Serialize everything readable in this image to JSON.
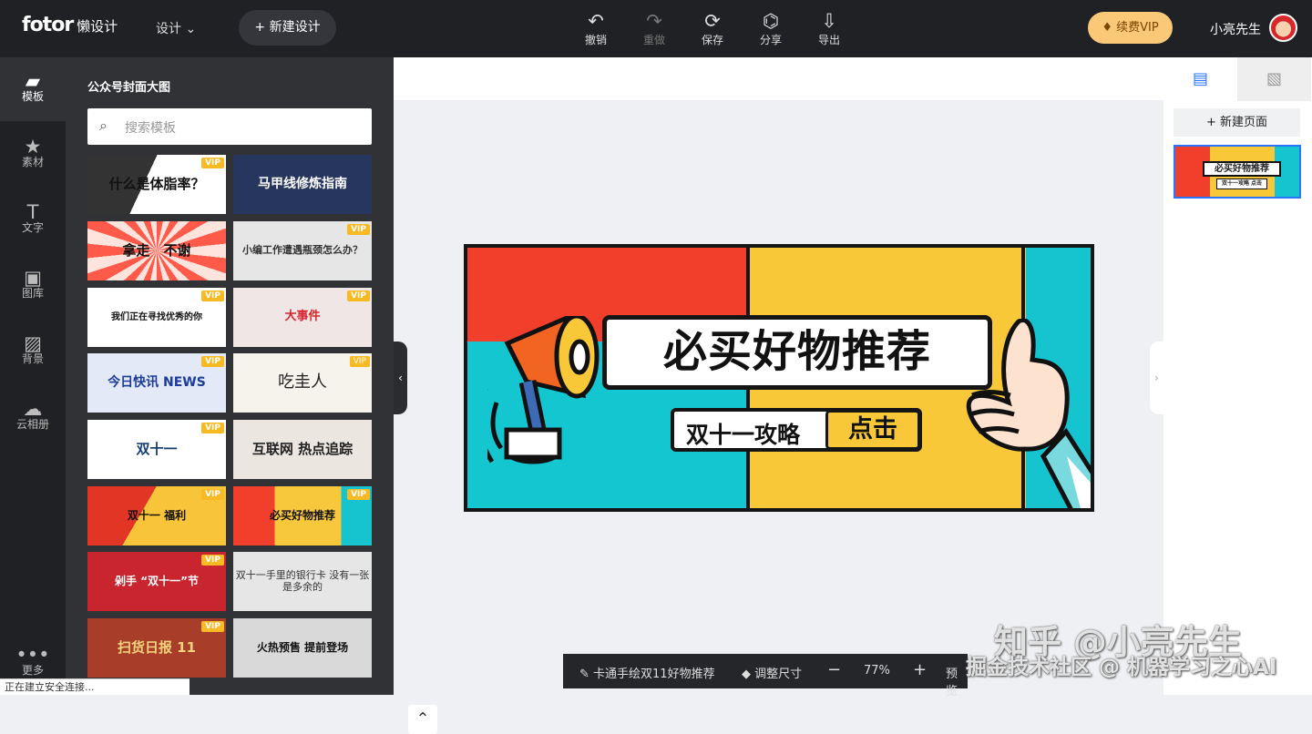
{
  "app": {
    "logo": "fotor",
    "logo_sub": "懒设计",
    "design_menu": "设计 ⌄",
    "new_design": "+ 新建设计"
  },
  "toolbar": {
    "undo": "撤销",
    "redo": "重做",
    "save": "保存",
    "share": "分享",
    "export": "导出",
    "vip": "续费VIP",
    "user": "小亮先生"
  },
  "icons": {
    "undo": "undo-icon",
    "redo": "redo-icon",
    "save": "save-icon",
    "share": "share-icon",
    "export": "export-icon"
  },
  "rail": [
    {
      "label": "模板"
    },
    {
      "label": "素材"
    },
    {
      "label": "文字"
    },
    {
      "label": "图库"
    },
    {
      "label": "背景"
    },
    {
      "label": "云相册"
    },
    {
      "label": "更多"
    }
  ],
  "panel": {
    "title": "公众号封面大图",
    "search_placeholder": "搜索模板"
  },
  "templates": [
    {
      "text": "什么是体脂率？",
      "vip": "VIP"
    },
    {
      "text": "马甲线修炼指南",
      "vip": ""
    },
    {
      "text": "拿走　不谢",
      "vip": ""
    },
    {
      "text": "小编工作遭遇瓶颈怎么办？",
      "vip": "VIP"
    },
    {
      "text": "我们正在寻找优秀的你",
      "vip": "VIP"
    },
    {
      "text": "大事件",
      "vip": "VIP"
    },
    {
      "text": "今日快讯 NEWS",
      "vip": "VIP"
    },
    {
      "text": "吃圭人",
      "vip": "VIP"
    },
    {
      "text": "双十一",
      "vip": "VIP"
    },
    {
      "text": "互联网 热点追踪",
      "vip": ""
    },
    {
      "text": "双十一 福利",
      "vip": "VIP"
    },
    {
      "text": "必买好物推荐",
      "vip": "VIP"
    },
    {
      "text": "剁手 “双十一”节",
      "vip": "VIP"
    },
    {
      "text": "双十一手里的银行卡 没有一张是多余的",
      "vip": ""
    },
    {
      "text": "扫货日报 11",
      "vip": "VIP"
    },
    {
      "text": "火热预售 提前登场",
      "vip": ""
    }
  ],
  "canvas": {
    "headline": "必买好物推荐",
    "strategy": "双十一攻略",
    "click": "点击"
  },
  "right_panel": {
    "new_page": "+ 新建页面",
    "mini_headline": "必买好物推荐",
    "mini_sub": "双十一攻略  点击"
  },
  "bottom": {
    "doc_name": "✎ 卡通手绘双11好物推荐",
    "resize": "◆ 调整尺寸",
    "minus": "−",
    "zoom": "77%",
    "plus": "+",
    "preview": "预览"
  },
  "watermark": {
    "line1": "知乎 @小亮先生",
    "line2": "掘金技术社区 @ 机器学习之心AI"
  },
  "status": "正在建立安全连接..."
}
